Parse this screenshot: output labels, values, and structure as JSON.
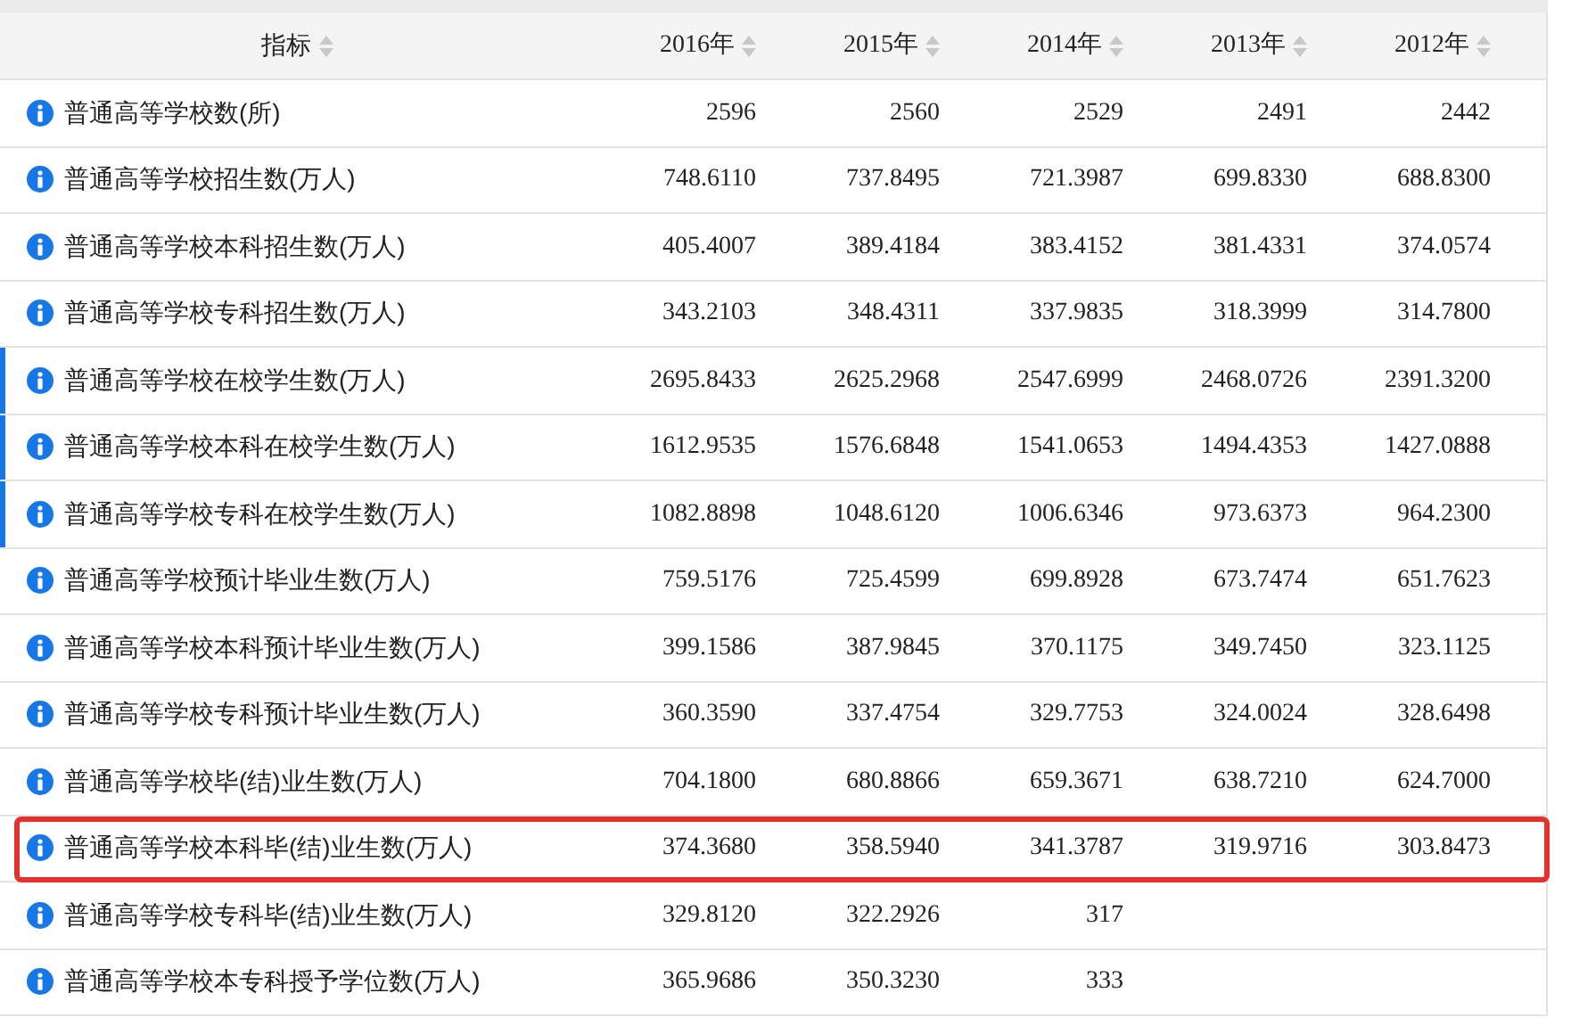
{
  "table": {
    "columns": [
      {
        "label": "指标"
      },
      {
        "label": "2016年"
      },
      {
        "label": "2015年"
      },
      {
        "label": "2014年"
      },
      {
        "label": "2013年"
      },
      {
        "label": "2012年"
      }
    ],
    "rows": [
      {
        "label": "普通高等学校数(所)",
        "marked": false,
        "highlighted": false,
        "values": [
          "2596",
          "2560",
          "2529",
          "2491",
          "2442"
        ]
      },
      {
        "label": "普通高等学校招生数(万人)",
        "marked": false,
        "highlighted": false,
        "values": [
          "748.6110",
          "737.8495",
          "721.3987",
          "699.8330",
          "688.8300"
        ]
      },
      {
        "label": "普通高等学校本科招生数(万人)",
        "marked": false,
        "highlighted": false,
        "values": [
          "405.4007",
          "389.4184",
          "383.4152",
          "381.4331",
          "374.0574"
        ]
      },
      {
        "label": "普通高等学校专科招生数(万人)",
        "marked": false,
        "highlighted": false,
        "values": [
          "343.2103",
          "348.4311",
          "337.9835",
          "318.3999",
          "314.7800"
        ]
      },
      {
        "label": "普通高等学校在校学生数(万人)",
        "marked": true,
        "highlighted": false,
        "values": [
          "2695.8433",
          "2625.2968",
          "2547.6999",
          "2468.0726",
          "2391.3200"
        ]
      },
      {
        "label": "普通高等学校本科在校学生数(万人)",
        "marked": true,
        "highlighted": false,
        "values": [
          "1612.9535",
          "1576.6848",
          "1541.0653",
          "1494.4353",
          "1427.0888"
        ]
      },
      {
        "label": "普通高等学校专科在校学生数(万人)",
        "marked": true,
        "highlighted": false,
        "values": [
          "1082.8898",
          "1048.6120",
          "1006.6346",
          "973.6373",
          "964.2300"
        ]
      },
      {
        "label": "普通高等学校预计毕业生数(万人)",
        "marked": false,
        "highlighted": false,
        "values": [
          "759.5176",
          "725.4599",
          "699.8928",
          "673.7474",
          "651.7623"
        ]
      },
      {
        "label": "普通高等学校本科预计毕业生数(万人)",
        "marked": false,
        "highlighted": false,
        "values": [
          "399.1586",
          "387.9845",
          "370.1175",
          "349.7450",
          "323.1125"
        ]
      },
      {
        "label": "普通高等学校专科预计毕业生数(万人)",
        "marked": false,
        "highlighted": false,
        "values": [
          "360.3590",
          "337.4754",
          "329.7753",
          "324.0024",
          "328.6498"
        ]
      },
      {
        "label": "普通高等学校毕(结)业生数(万人)",
        "marked": false,
        "highlighted": false,
        "values": [
          "704.1800",
          "680.8866",
          "659.3671",
          "638.7210",
          "624.7000"
        ]
      },
      {
        "label": "普通高等学校本科毕(结)业生数(万人)",
        "marked": false,
        "highlighted": true,
        "values": [
          "374.3680",
          "358.5940",
          "341.3787",
          "319.9716",
          "303.8473"
        ]
      },
      {
        "label": "普通高等学校专科毕(结)业生数(万人)",
        "marked": false,
        "highlighted": false,
        "values": [
          "329.8120",
          "322.2926",
          "317"
        ]
      },
      {
        "label": "普通高等学校本专科授予学位数(万人)",
        "marked": false,
        "highlighted": false,
        "values": [
          "365.9686",
          "350.3230",
          "333"
        ]
      }
    ]
  }
}
